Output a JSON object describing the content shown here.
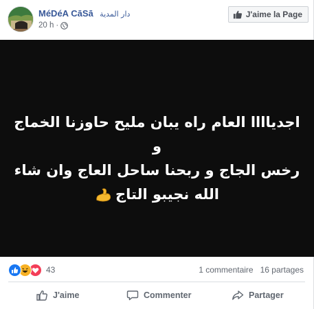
{
  "post": {
    "page_name": "MéDéA CāSā",
    "page_subname": "دار المدية",
    "time": "20 h",
    "like_page_label": "J'aime la Page",
    "image_text_lines": [
      "اجدياااا العام راه يبان مليح حاوزنا الخماج و",
      "رخس الجاج و ربحنا ساحل العاج وان شاء",
      "الله نجيبو التاج"
    ]
  },
  "reactions": {
    "types": [
      "like-icon",
      "haha-icon",
      "love-icon"
    ],
    "count": "43"
  },
  "stats": {
    "comments": "1 commentaire",
    "shares": "16 partages"
  },
  "actions": {
    "like_label": "J'aime",
    "comment_label": "Commenter",
    "share_label": "Partager"
  },
  "colors": {
    "link": "#385898",
    "like_blue": "#1877f2",
    "love_red": "#f33e58",
    "haha_yellow": "#f7b125",
    "media_bg": "#0d0d0d"
  }
}
